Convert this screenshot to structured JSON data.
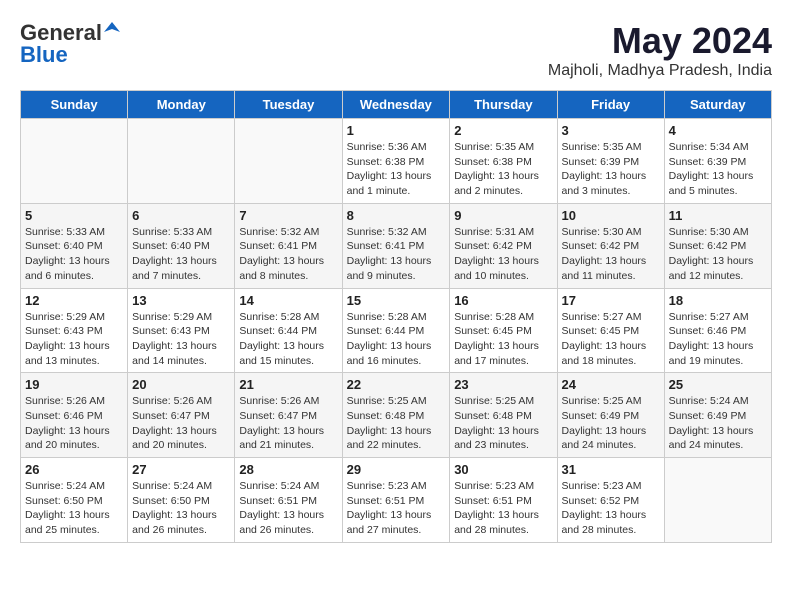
{
  "logo": {
    "general": "General",
    "blue": "Blue"
  },
  "title": "May 2024",
  "location": "Majholi, Madhya Pradesh, India",
  "weekdays": [
    "Sunday",
    "Monday",
    "Tuesday",
    "Wednesday",
    "Thursday",
    "Friday",
    "Saturday"
  ],
  "weeks": [
    [
      {
        "day": "",
        "info": ""
      },
      {
        "day": "",
        "info": ""
      },
      {
        "day": "",
        "info": ""
      },
      {
        "day": "1",
        "info": "Sunrise: 5:36 AM\nSunset: 6:38 PM\nDaylight: 13 hours\nand 1 minute."
      },
      {
        "day": "2",
        "info": "Sunrise: 5:35 AM\nSunset: 6:38 PM\nDaylight: 13 hours\nand 2 minutes."
      },
      {
        "day": "3",
        "info": "Sunrise: 5:35 AM\nSunset: 6:39 PM\nDaylight: 13 hours\nand 3 minutes."
      },
      {
        "day": "4",
        "info": "Sunrise: 5:34 AM\nSunset: 6:39 PM\nDaylight: 13 hours\nand 5 minutes."
      }
    ],
    [
      {
        "day": "5",
        "info": "Sunrise: 5:33 AM\nSunset: 6:40 PM\nDaylight: 13 hours\nand 6 minutes."
      },
      {
        "day": "6",
        "info": "Sunrise: 5:33 AM\nSunset: 6:40 PM\nDaylight: 13 hours\nand 7 minutes."
      },
      {
        "day": "7",
        "info": "Sunrise: 5:32 AM\nSunset: 6:41 PM\nDaylight: 13 hours\nand 8 minutes."
      },
      {
        "day": "8",
        "info": "Sunrise: 5:32 AM\nSunset: 6:41 PM\nDaylight: 13 hours\nand 9 minutes."
      },
      {
        "day": "9",
        "info": "Sunrise: 5:31 AM\nSunset: 6:42 PM\nDaylight: 13 hours\nand 10 minutes."
      },
      {
        "day": "10",
        "info": "Sunrise: 5:30 AM\nSunset: 6:42 PM\nDaylight: 13 hours\nand 11 minutes."
      },
      {
        "day": "11",
        "info": "Sunrise: 5:30 AM\nSunset: 6:42 PM\nDaylight: 13 hours\nand 12 minutes."
      }
    ],
    [
      {
        "day": "12",
        "info": "Sunrise: 5:29 AM\nSunset: 6:43 PM\nDaylight: 13 hours\nand 13 minutes."
      },
      {
        "day": "13",
        "info": "Sunrise: 5:29 AM\nSunset: 6:43 PM\nDaylight: 13 hours\nand 14 minutes."
      },
      {
        "day": "14",
        "info": "Sunrise: 5:28 AM\nSunset: 6:44 PM\nDaylight: 13 hours\nand 15 minutes."
      },
      {
        "day": "15",
        "info": "Sunrise: 5:28 AM\nSunset: 6:44 PM\nDaylight: 13 hours\nand 16 minutes."
      },
      {
        "day": "16",
        "info": "Sunrise: 5:28 AM\nSunset: 6:45 PM\nDaylight: 13 hours\nand 17 minutes."
      },
      {
        "day": "17",
        "info": "Sunrise: 5:27 AM\nSunset: 6:45 PM\nDaylight: 13 hours\nand 18 minutes."
      },
      {
        "day": "18",
        "info": "Sunrise: 5:27 AM\nSunset: 6:46 PM\nDaylight: 13 hours\nand 19 minutes."
      }
    ],
    [
      {
        "day": "19",
        "info": "Sunrise: 5:26 AM\nSunset: 6:46 PM\nDaylight: 13 hours\nand 20 minutes."
      },
      {
        "day": "20",
        "info": "Sunrise: 5:26 AM\nSunset: 6:47 PM\nDaylight: 13 hours\nand 20 minutes."
      },
      {
        "day": "21",
        "info": "Sunrise: 5:26 AM\nSunset: 6:47 PM\nDaylight: 13 hours\nand 21 minutes."
      },
      {
        "day": "22",
        "info": "Sunrise: 5:25 AM\nSunset: 6:48 PM\nDaylight: 13 hours\nand 22 minutes."
      },
      {
        "day": "23",
        "info": "Sunrise: 5:25 AM\nSunset: 6:48 PM\nDaylight: 13 hours\nand 23 minutes."
      },
      {
        "day": "24",
        "info": "Sunrise: 5:25 AM\nSunset: 6:49 PM\nDaylight: 13 hours\nand 24 minutes."
      },
      {
        "day": "25",
        "info": "Sunrise: 5:24 AM\nSunset: 6:49 PM\nDaylight: 13 hours\nand 24 minutes."
      }
    ],
    [
      {
        "day": "26",
        "info": "Sunrise: 5:24 AM\nSunset: 6:50 PM\nDaylight: 13 hours\nand 25 minutes."
      },
      {
        "day": "27",
        "info": "Sunrise: 5:24 AM\nSunset: 6:50 PM\nDaylight: 13 hours\nand 26 minutes."
      },
      {
        "day": "28",
        "info": "Sunrise: 5:24 AM\nSunset: 6:51 PM\nDaylight: 13 hours\nand 26 minutes."
      },
      {
        "day": "29",
        "info": "Sunrise: 5:23 AM\nSunset: 6:51 PM\nDaylight: 13 hours\nand 27 minutes."
      },
      {
        "day": "30",
        "info": "Sunrise: 5:23 AM\nSunset: 6:51 PM\nDaylight: 13 hours\nand 28 minutes."
      },
      {
        "day": "31",
        "info": "Sunrise: 5:23 AM\nSunset: 6:52 PM\nDaylight: 13 hours\nand 28 minutes."
      },
      {
        "day": "",
        "info": ""
      }
    ]
  ]
}
